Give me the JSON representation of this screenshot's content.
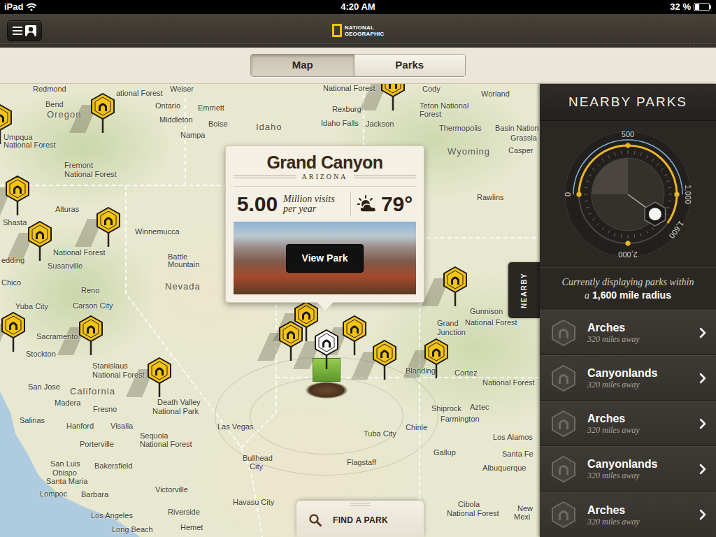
{
  "status_bar": {
    "device": "iPad",
    "time": "4:20 AM",
    "battery": "32 %",
    "battery_level": 0.32
  },
  "header": {
    "logo": [
      "NATIONAL",
      "GEOGRAPHIC"
    ]
  },
  "tabs": [
    {
      "label": "Map",
      "selected": true
    },
    {
      "label": "Parks",
      "selected": false
    }
  ],
  "map": {
    "regions": [
      "Oregon",
      "Idaho",
      "Nevada",
      "California",
      "Wyoming"
    ],
    "places": [
      "Redmond",
      "Bend",
      "ational Forest",
      "Weiser",
      "Ontario",
      "Emmett",
      "Middleton",
      "Boise",
      "Nampa",
      "National Forest",
      "Cody",
      "Rexburg",
      "Teton National",
      "Forest",
      "Worland",
      "Idaho Falls",
      "Jackson",
      "Thermopolis",
      "Basin Nation",
      "Grassla",
      "Umpqua",
      "National Forest",
      "Casper",
      "Fremont",
      "National Forest",
      "Rawlins",
      "Alturas",
      "Shasta",
      "Winnemucca",
      "National Forest",
      "Susanville",
      "edding",
      "Battle",
      "Mountain",
      "Chico",
      "Reno",
      "Carson City",
      "Yuba City",
      "Sacramento",
      "Stockton",
      "Stanislaus",
      "National Forest",
      "Gunnison",
      "National Forest",
      "Grand",
      "Junction",
      "San Jose",
      "Madera",
      "Fresno",
      "Salinas",
      "Hanford",
      "Visalia",
      "Death Valley",
      "National Park",
      "Porterville",
      "Sequoia",
      "National Forest",
      "Bakersfield",
      "San Luis",
      "Obispo",
      "Santa Maria",
      "Lompoc",
      "Barbara",
      "Victorville",
      "Los Angeles",
      "Long Beach",
      "Riverside",
      "Hemet",
      "Havasu City",
      "Las Vegas",
      "Bullhead",
      "City",
      "Flagstaff",
      "Tuba City",
      "Chinle",
      "Blanding",
      "Cortez",
      "National Forest",
      "Shiprock",
      "Aztec",
      "Farmington",
      "Los Alamos",
      "Gallup",
      "Santa Fe",
      "Albuquerque",
      "Cibola",
      "National Forest",
      "New",
      "Mexi"
    ],
    "pins": [
      {
        "selected": false
      },
      {
        "selected": false
      },
      {
        "selected": false
      },
      {
        "selected": false
      },
      {
        "selected": false
      },
      {
        "selected": false
      },
      {
        "selected": false
      },
      {
        "selected": false
      },
      {
        "selected": false
      },
      {
        "selected": false
      },
      {
        "selected": false
      },
      {
        "selected": false
      },
      {
        "selected": false
      },
      {
        "selected": false
      },
      {
        "selected": false
      },
      {
        "selected": true
      }
    ]
  },
  "popup": {
    "title": "Grand Canyon",
    "state": "ARIZONA",
    "visits": "5.00",
    "visits_label": "Million visits per year",
    "temperature": "79°",
    "button": "View Park"
  },
  "find_park": {
    "label": "FIND A PARK"
  },
  "nearby": {
    "title": "NEARBY PARKS",
    "side_tab": "NEARBY",
    "dial": {
      "ticks": [
        "0",
        "500",
        "1,000",
        "2,000"
      ],
      "reading": "1,600",
      "level": 0.8
    },
    "caption": "Currently displaying parks within a",
    "radius": "1,600 mile radius",
    "parks": [
      {
        "name": "Arches",
        "distance": "320 miles away"
      },
      {
        "name": "Canyonlands",
        "distance": "320 miles away"
      },
      {
        "name": "Arches",
        "distance": "320 miles away"
      },
      {
        "name": "Canyonlands",
        "distance": "320 miles away"
      },
      {
        "name": "Arches",
        "distance": "320 miles away"
      }
    ]
  }
}
